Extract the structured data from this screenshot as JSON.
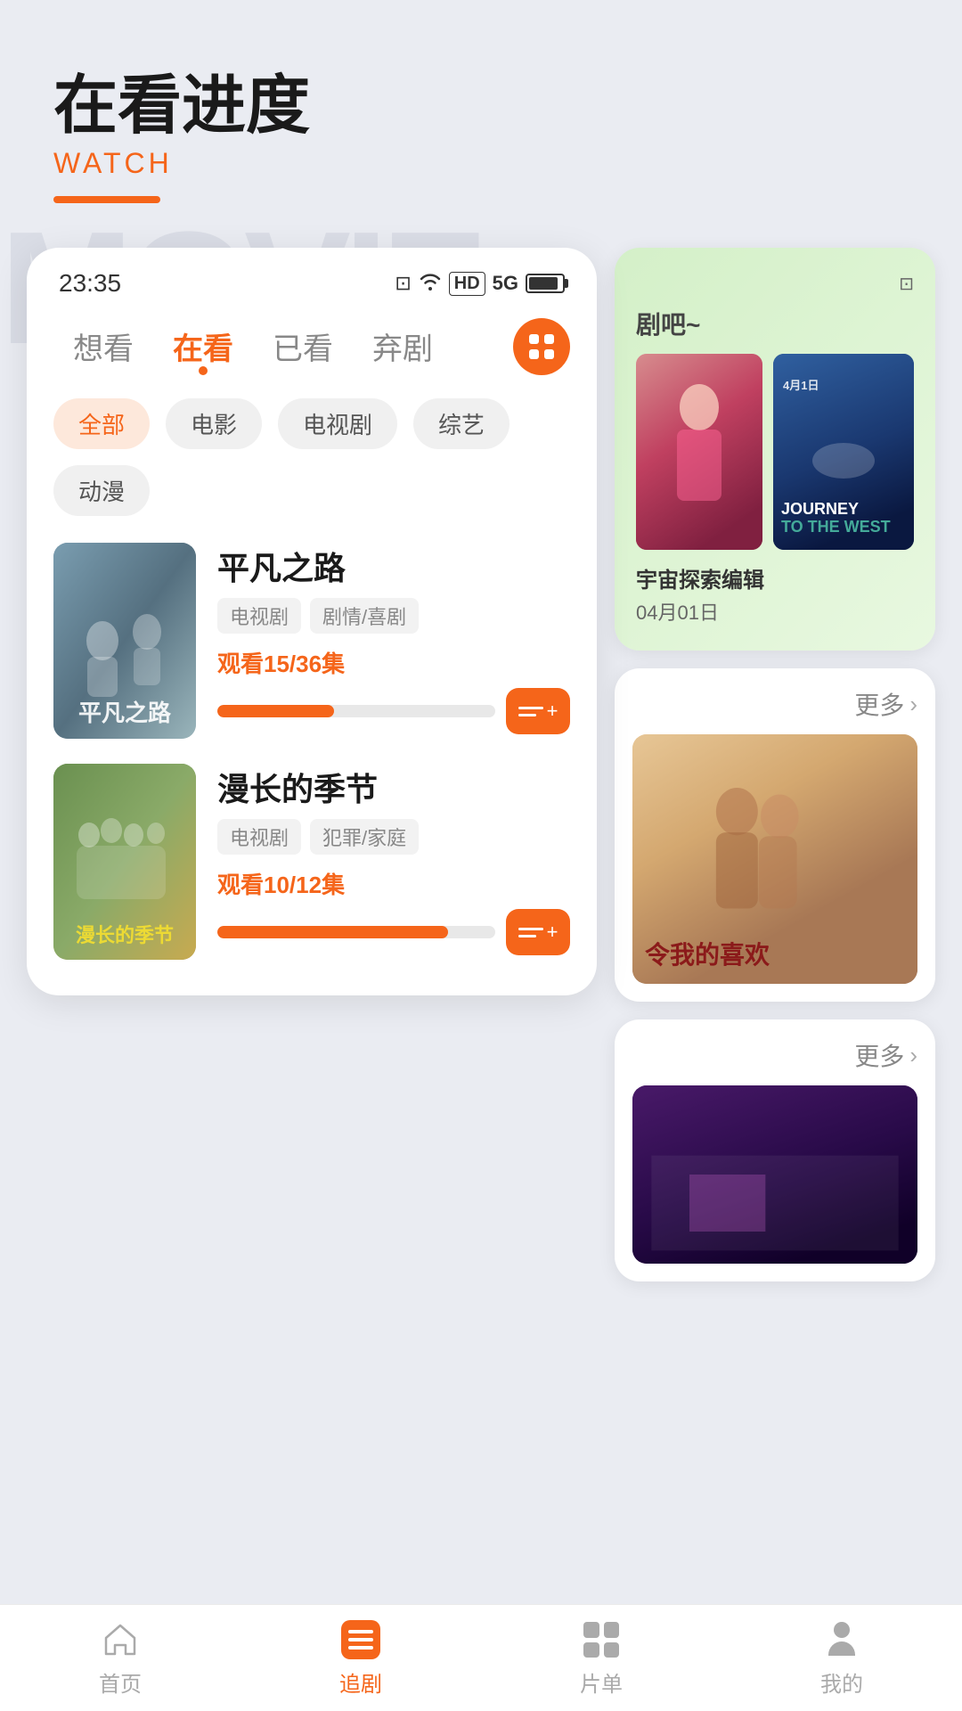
{
  "header": {
    "title": "在看进度",
    "subtitle": "WATCH",
    "underline_color": "#f5651a"
  },
  "watermark": "MOVIE",
  "status_bar": {
    "time": "23:35",
    "icons": [
      "NFC",
      "WiFi",
      "HD",
      "5G",
      "100"
    ]
  },
  "tabs": [
    {
      "label": "想看",
      "active": false
    },
    {
      "label": "在看",
      "active": true
    },
    {
      "label": "已看",
      "active": false
    },
    {
      "label": "弃剧",
      "active": false
    }
  ],
  "filters": [
    {
      "label": "全部",
      "active": true
    },
    {
      "label": "电影",
      "active": false
    },
    {
      "label": "电视剧",
      "active": false
    },
    {
      "label": "综艺",
      "active": false
    },
    {
      "label": "动漫",
      "active": false
    }
  ],
  "watching_items": [
    {
      "title": "平凡之路",
      "tags": [
        "电视剧",
        "剧情/喜剧"
      ],
      "progress_label": "观看15/36集",
      "progress_pct": 42,
      "poster_type": "pingfan"
    },
    {
      "title": "漫长的季节",
      "tags": [
        "电视剧",
        "犯罪/家庭"
      ],
      "progress_label": "观看10/12集",
      "progress_pct": 83,
      "poster_type": "mancang"
    }
  ],
  "right_card_top": {
    "drama_text": "剧吧~",
    "movie1": {
      "title": "Journey to the West",
      "date_badge": "4月1日"
    },
    "movie_info_title": "宇宙探索编辑",
    "movie_info_date": "04月01日"
  },
  "right_card_more1": {
    "label": "更多",
    "poster_title": "令我的喜欢"
  },
  "right_card_more2": {
    "label": "更多"
  },
  "bottom_nav": [
    {
      "label": "首页",
      "icon": "home-icon",
      "active": false
    },
    {
      "label": "追剧",
      "icon": "drama-icon",
      "active": true
    },
    {
      "label": "片单",
      "icon": "list-grid-icon",
      "active": false
    },
    {
      "label": "我的",
      "icon": "profile-icon",
      "active": false
    }
  ]
}
